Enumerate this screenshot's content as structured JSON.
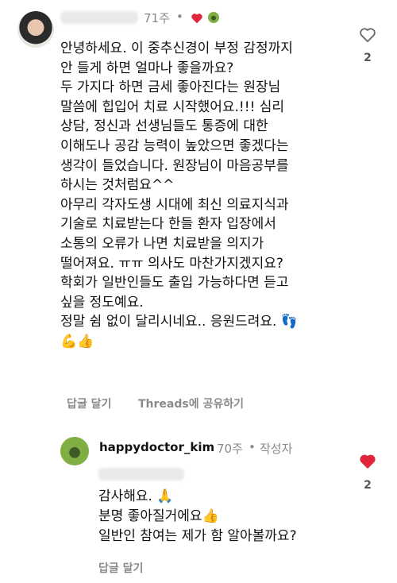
{
  "comment": {
    "time": "71주",
    "separator": "•",
    "author_heart_color": "#e0263a",
    "body_lines": [
      "안녕하세요. 이 중추신경이 부정 감정까지",
      "안 들게 하면 얼마나 좋을까요?",
      "두 가지다 하면 금세 좋아진다는 원장님",
      "말씀에 힙입어 치료 시작했어요.!!! 심리",
      "상담, 정신과 선생님들도 통증에 대한",
      "이해도나 공감 능력이 높았으면 좋겠다는",
      "생각이 들었습니다. 원장님이 마음공부를",
      "하시는 것처럼요^^",
      "아무리 각자도생 시대에 최신 의료지식과",
      "기술로 치료받는다 한들 환자 입장에서",
      "소통의 오류가 나면 치료받을 의지가",
      "떨어져요. ㅠㅠ 의사도 마찬가지겠지요?",
      "학회가 일반인들도 출입 가능하다면 듣고",
      "싶을 정도예요.",
      "정말 쉼 없이 달리시네요.. 응원드려요. 👣",
      "💪👍"
    ],
    "reply_action": "답글 달기",
    "share_action": "Threads에 공유하기",
    "like_count": "2"
  },
  "reply": {
    "username": "happydoctor_kim",
    "time": "70주",
    "separator": "•",
    "author_label": "작성자",
    "body_lines": [
      "감사해요. 🙏",
      "분명 좋아질거에요👍",
      "일반인 참여는 제가 함 알아볼까요?"
    ],
    "reply_action": "답글 달기",
    "like_count": "2",
    "liked_color": "#e0263a"
  }
}
